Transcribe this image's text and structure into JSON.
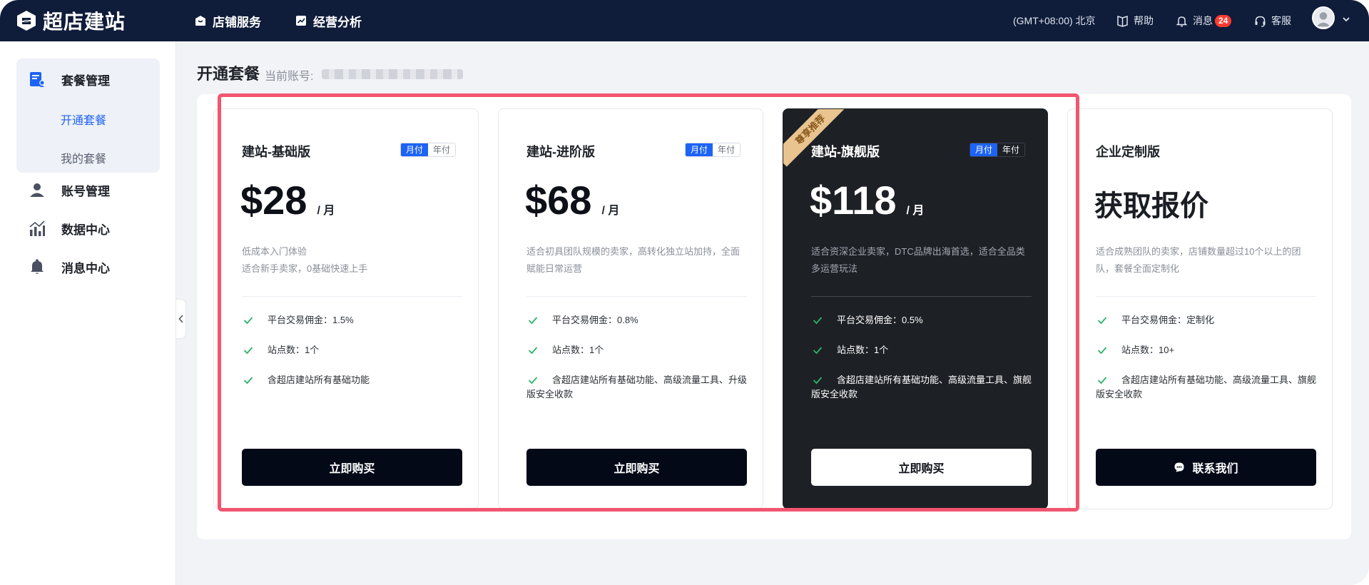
{
  "header": {
    "logo_text": "超店建站",
    "nav": [
      {
        "label": "店铺服务",
        "icon": "shop-icon"
      },
      {
        "label": "经营分析",
        "icon": "chart-icon"
      }
    ],
    "timezone": "(GMT+08:00) 北京",
    "help_label": "帮助",
    "message_label": "消息",
    "message_count": "24",
    "service_label": "客服"
  },
  "sidebar": {
    "items": [
      {
        "label": "套餐管理",
        "icon": "package-icon"
      },
      {
        "label": "账号管理",
        "icon": "user-icon"
      },
      {
        "label": "数据中心",
        "icon": "data-chart-icon"
      },
      {
        "label": "消息中心",
        "icon": "bell-icon"
      }
    ],
    "subitems": [
      {
        "label": "开通套餐",
        "active": true
      },
      {
        "label": "我的套餐",
        "active": false
      }
    ]
  },
  "main": {
    "title": "开通套餐",
    "account_label": "当前账号:",
    "plans": [
      {
        "name": "建站-基础版",
        "toggle": [
          "月付",
          "年付"
        ],
        "price": "$28",
        "unit": "/ 月",
        "desc": [
          "低成本入门体验",
          "适合新手卖家，0基础快速上手"
        ],
        "features": [
          "平台交易佣金：1.5%",
          "站点数：1个",
          "含超店建站所有基础功能"
        ],
        "cta": "立即购买"
      },
      {
        "name": "建站-进阶版",
        "toggle": [
          "月付",
          "年付"
        ],
        "price": "$68",
        "unit": "/ 月",
        "desc": [
          "适合初具团队规模的卖家，高转化独立站加持，全面赋能日常运营"
        ],
        "features": [
          "平台交易佣金：0.8%",
          "站点数：1个",
          "含超店建站所有基础功能、高级流量工具、升级版安全收款"
        ],
        "cta": "立即购买"
      },
      {
        "name": "建站-旗舰版",
        "ribbon": "尊享推荐",
        "toggle": [
          "月付",
          "年付"
        ],
        "price": "$118",
        "unit": "/ 月",
        "desc": [
          "适合资深企业卖家，DTC品牌出海首选，适合全品类多运营玩法"
        ],
        "features": [
          "平台交易佣金：0.5%",
          "站点数：1个",
          "含超店建站所有基础功能、高级流量工具、旗舰版安全收款"
        ],
        "cta": "立即购买"
      },
      {
        "name": "企业定制版",
        "quote": "获取报价",
        "desc": [
          "适合成熟团队的卖家，店铺数量超过10个以上的团队，套餐全面定制化"
        ],
        "features": [
          "平台交易佣金：定制化",
          "站点数：10+",
          "含超店建站所有基础功能、高级流量工具、旗舰版安全收款"
        ],
        "cta": "联系我们"
      }
    ]
  },
  "colors": {
    "topbar": "#0f1c3a",
    "accent": "#1d63f5",
    "check": "#2db36b",
    "highlight": "#f25570",
    "premium_card": "#1d2025"
  }
}
